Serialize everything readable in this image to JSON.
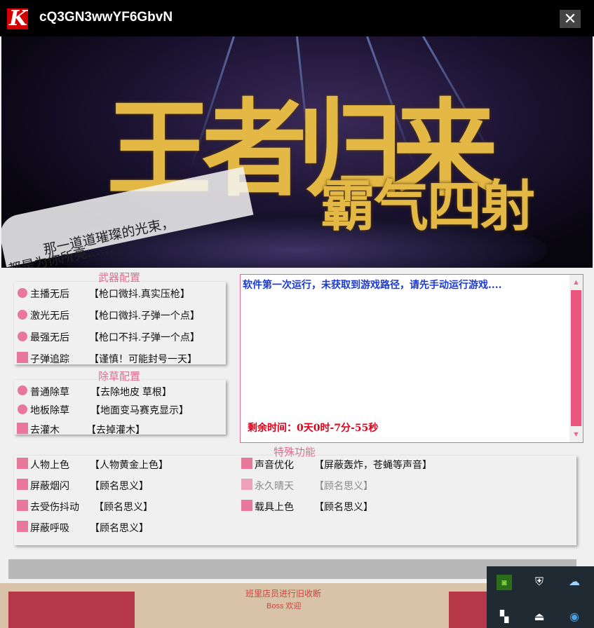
{
  "window": {
    "title": "cQ3GN3wwYF6GbvN",
    "logo_letter": "K",
    "close_label": "✕"
  },
  "banner": {
    "headline": "王者归来",
    "sub": "霸气四射",
    "slogan_line1": "那一道道璀璨的光束，",
    "slogan_line2": "都是为你所亮……"
  },
  "weapon_group": {
    "title": "武器配置",
    "items": [
      {
        "name": "主播无后",
        "desc": "【枪口微抖.真实压枪】"
      },
      {
        "name": "激光无后",
        "desc": "【枪口微抖.子弹一个点】"
      },
      {
        "name": "最强无后",
        "desc": "【枪口不抖.子弹一个点】"
      },
      {
        "name": "子弹追踪",
        "desc": "【谨慎！可能封号一天】"
      }
    ]
  },
  "grass_group": {
    "title": "除草配置",
    "items": [
      {
        "name": "普通除草",
        "desc": "【去除地皮 草根】"
      },
      {
        "name": "地板除草",
        "desc": "【地面变马赛克显示】"
      },
      {
        "name": "去灌木",
        "desc": "【去掉灌木】"
      }
    ]
  },
  "special_group": {
    "title": "特殊功能",
    "left_items": [
      {
        "name": "人物上色",
        "desc": "【人物黄金上色】"
      },
      {
        "name": "屏蔽烟闪",
        "desc": "【顾名思义】"
      },
      {
        "name": "去受伤抖动",
        "desc": "【顾名思义】"
      },
      {
        "name": "屏蔽呼吸",
        "desc": "【顾名思义】"
      }
    ],
    "right_items": [
      {
        "name": "声音优化",
        "desc": "【屏蔽轰炸，苍蝇等声音】"
      },
      {
        "name": "永久晴天",
        "desc": "【顾名思义】"
      },
      {
        "name": "载具上色",
        "desc": "【顾名思义】"
      }
    ]
  },
  "log": {
    "message": "软件第一次运行，未获取到游戏路径，请先手动运行游戏....",
    "remaining": "剩余时间：0天0时-7分-55秒"
  },
  "bottom_strip": {
    "text1": "班里店员进行旧收断",
    "text2": "Boss 欢迎"
  },
  "colors": {
    "accent": "#e9769b",
    "log_text": "#1a3ad8",
    "timer_text": "#e0001a"
  }
}
